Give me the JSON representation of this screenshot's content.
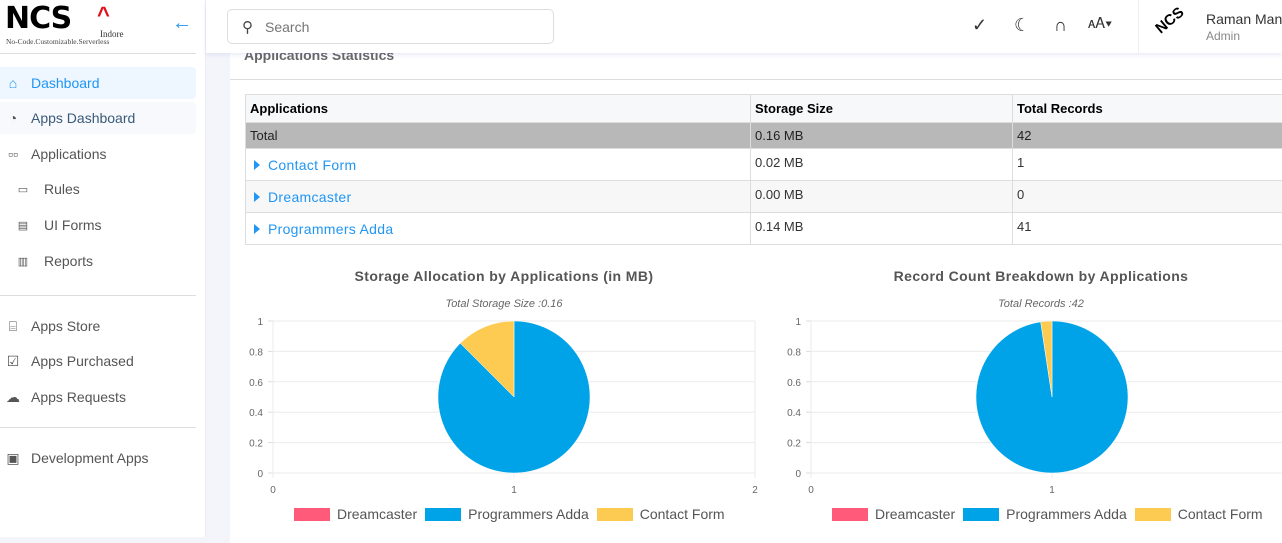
{
  "brand": {
    "logo_text": "NCS",
    "logo_caret": "^",
    "logo_location": "Indore",
    "logo_tagline": "No-Code.Customizable.Serverless"
  },
  "sidebar": {
    "collapse_icon": "arrow-left-icon",
    "items": [
      {
        "label": "Dashboard",
        "icon": "home-icon",
        "active": true
      },
      {
        "label": "Apps Dashboard",
        "icon": "speedometer-icon"
      },
      {
        "label": "Applications",
        "icon": "grid-icon"
      },
      {
        "label": "Rules",
        "icon": "rules-icon"
      },
      {
        "label": "UI Forms",
        "icon": "form-icon"
      },
      {
        "label": "Reports",
        "icon": "report-icon"
      },
      {
        "label": "Apps Store",
        "icon": "store-icon"
      },
      {
        "label": "Apps Purchased",
        "icon": "bag-check-icon"
      },
      {
        "label": "Apps Requests",
        "icon": "cloud-download-icon"
      },
      {
        "label": "Development Apps",
        "icon": "user-screen-icon"
      }
    ]
  },
  "topbar": {
    "search_placeholder": "Search",
    "user_name": "Raman Man",
    "user_role": "Admin",
    "avatar_text": "NCS"
  },
  "main": {
    "section_title": "Applications Statistics",
    "table": {
      "headers": [
        "Applications",
        "Storage Size",
        "Total Records"
      ],
      "total": {
        "label": "Total",
        "storage": "0.16 MB",
        "records": "42"
      },
      "rows": [
        {
          "app": "Contact Form",
          "storage": "0.02 MB",
          "records": "1"
        },
        {
          "app": "Dreamcaster",
          "storage": "0.00 MB",
          "records": "0"
        },
        {
          "app": "Programmers Adda",
          "storage": "0.14 MB",
          "records": "41"
        }
      ]
    }
  },
  "chart_data": [
    {
      "type": "pie",
      "title": "Storage Allocation by Applications (in MB)",
      "subtitle": "Total Storage Size :0.16",
      "labels": [
        "Dreamcaster",
        "Programmers Adda",
        "Contact Form"
      ],
      "values": [
        0,
        0.14,
        0.02
      ],
      "colors": [
        "#ff5a7a",
        "#00a3e8",
        "#fecb52"
      ],
      "y_ticks": [
        "0",
        "0.2",
        "0.4",
        "0.6",
        "0.8",
        "1"
      ],
      "x_ticks": [
        "0",
        "1",
        "2"
      ],
      "ylim": [
        0,
        1
      ],
      "xlim": [
        0,
        2
      ],
      "grid": true,
      "legend": "bottom"
    },
    {
      "type": "pie",
      "title": "Record Count Breakdown by Applications",
      "subtitle": "Total Records :42",
      "labels": [
        "Dreamcaster",
        "Programmers Adda",
        "Contact Form"
      ],
      "values": [
        0,
        41,
        1
      ],
      "colors": [
        "#ff5a7a",
        "#00a3e8",
        "#fecb52"
      ],
      "y_ticks": [
        "0",
        "0.2",
        "0.4",
        "0.6",
        "0.8",
        "1"
      ],
      "x_ticks": [
        "0",
        "1"
      ],
      "ylim": [
        0,
        1
      ],
      "xlim": [
        0,
        2
      ],
      "grid": true,
      "legend": "bottom"
    }
  ]
}
